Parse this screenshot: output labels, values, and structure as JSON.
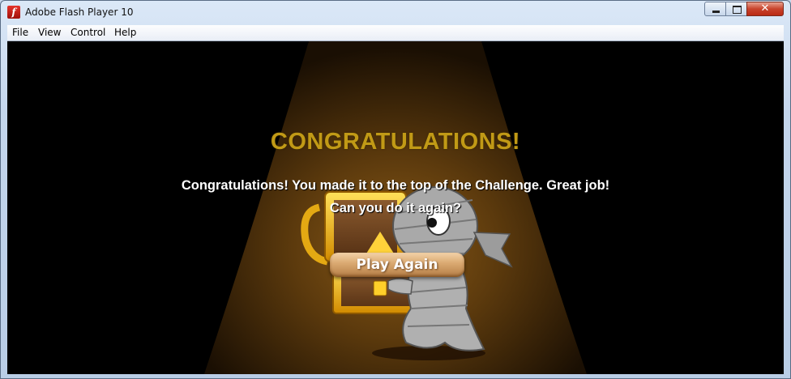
{
  "window": {
    "title": "Adobe Flash Player 10",
    "icon": "flash-player-icon",
    "controls": {
      "minimize": "minimize-icon",
      "maximize": "maximize-icon",
      "close_glyph": "✕"
    }
  },
  "menubar": {
    "items": [
      {
        "label": "File"
      },
      {
        "label": "View"
      },
      {
        "label": "Control"
      },
      {
        "label": "Help"
      }
    ]
  },
  "game": {
    "heading": "CONGRATULATIONS!",
    "message_line1": "Congratulations! You made it to the top of the Challenge. Great job!",
    "message_line2": "Can you do it again?",
    "play_again_label": "Play Again",
    "colors": {
      "heading": "#c19a16",
      "background": "#000000",
      "spotlight": "#8a5a17"
    }
  }
}
